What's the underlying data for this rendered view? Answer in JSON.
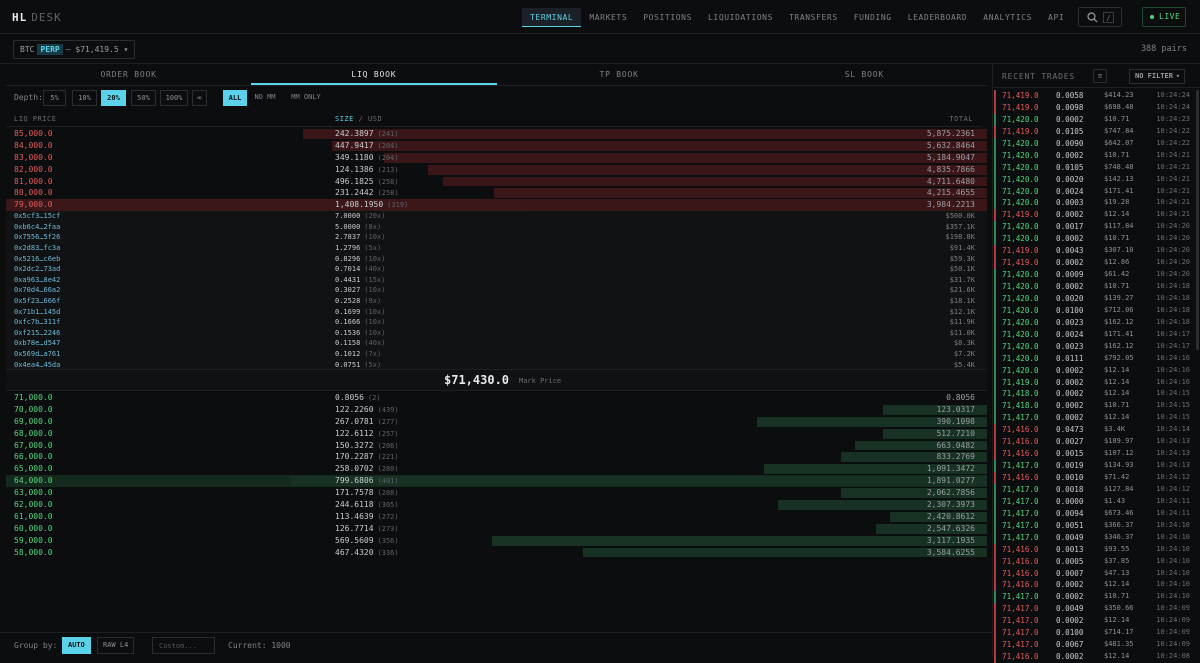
{
  "app": {
    "logo_main": "HL",
    "logo_sub": "DESK"
  },
  "nav": [
    "TERMINAL",
    "MARKETS",
    "POSITIONS",
    "LIQUIDATIONS",
    "TRANSFERS",
    "FUNDING",
    "LEADERBOARD",
    "ANALYTICS",
    "API"
  ],
  "search_shortcut": "/",
  "live_label": "LIVE",
  "pair": {
    "base": "BTC",
    "tag": "PERP",
    "price": "— $71,419.5",
    "caret": "▾"
  },
  "pairs_count": "388 pairs",
  "tabs": [
    "ORDER BOOK",
    "LIQ BOOK",
    "TP BOOK",
    "SL BOOK"
  ],
  "depth": {
    "label": "Depth:",
    "options": [
      "5%",
      "10%",
      "20%",
      "50%",
      "100%",
      "∞"
    ],
    "selected": "20%"
  },
  "mm_filter": {
    "options": [
      "ALL",
      "NO MM",
      "MM ONLY"
    ],
    "selected": "ALL"
  },
  "columns": {
    "price": "LIQ PRICE",
    "size": "SIZE",
    "sep": "/",
    "usd": "USD",
    "total": "TOTAL"
  },
  "asks": [
    {
      "price": "85,000.0",
      "size": "242.3897",
      "count": "(241)",
      "total": "5,875.2361",
      "depth": 0.93
    },
    {
      "price": "84,000.0",
      "size": "447.9417",
      "count": "(204)",
      "total": "5,632.8464",
      "depth": 0.89
    },
    {
      "price": "83,000.0",
      "size": "349.1180",
      "count": "(204)",
      "total": "5,184.9047",
      "depth": 0.82
    },
    {
      "price": "82,000.0",
      "size": "124.1386",
      "count": "(213)",
      "total": "4,835.7866",
      "depth": 0.76
    },
    {
      "price": "81,000.0",
      "size": "496.1825",
      "count": "(258)",
      "total": "4,711.6480",
      "depth": 0.74
    },
    {
      "price": "80,000.0",
      "size": "231.2442",
      "count": "(258)",
      "total": "4,215.4655",
      "depth": 0.67
    },
    {
      "price": "79,000.0",
      "size": "1,408.1950",
      "count": "(319)",
      "total": "3,984.2213",
      "depth": 0.63
    }
  ],
  "wallets": [
    {
      "addr": "0x5cf3…15cf",
      "size": "7.0000",
      "lev": "(20x)",
      "usd": "$500.0K"
    },
    {
      "addr": "0xb6c4…2faa",
      "size": "5.0000",
      "lev": "(8x)",
      "usd": "$357.1K"
    },
    {
      "addr": "0x7556…5f26",
      "size": "2.7837",
      "lev": "(10x)",
      "usd": "$198.8K"
    },
    {
      "addr": "0x2d83…fc3a",
      "size": "1.2796",
      "lev": "(5x)",
      "usd": "$91.4K"
    },
    {
      "addr": "0x5216…c6eb",
      "size": "0.8296",
      "lev": "(10x)",
      "usd": "$59.3K"
    },
    {
      "addr": "0x2dc2…73ad",
      "size": "0.7014",
      "lev": "(40x)",
      "usd": "$50.1K"
    },
    {
      "addr": "0xa963…8e42",
      "size": "0.4431",
      "lev": "(15x)",
      "usd": "$31.7K"
    },
    {
      "addr": "0x70d4…66a2",
      "size": "0.3027",
      "lev": "(10x)",
      "usd": "$21.6K"
    },
    {
      "addr": "0x5f23…666f",
      "size": "0.2528",
      "lev": "(9x)",
      "usd": "$18.1K"
    },
    {
      "addr": "0x71b1…145d",
      "size": "0.1699",
      "lev": "(10x)",
      "usd": "$12.1K"
    },
    {
      "addr": "0xfc7b…311f",
      "size": "0.1666",
      "lev": "(10x)",
      "usd": "$11.9K"
    },
    {
      "addr": "0xf215…2246",
      "size": "0.1536",
      "lev": "(10x)",
      "usd": "$11.0K"
    },
    {
      "addr": "0xb78e…d547",
      "size": "0.1158",
      "lev": "(40x)",
      "usd": "$8.3K"
    },
    {
      "addr": "0x569d…a761",
      "size": "0.1012",
      "lev": "(7x)",
      "usd": "$7.2K"
    },
    {
      "addr": "0x4ea4…45da",
      "size": "0.0751",
      "lev": "(5x)",
      "usd": "$5.4K"
    }
  ],
  "mark": {
    "price": "$71,430.0",
    "label": "Mark Price"
  },
  "bids": [
    {
      "price": "71,000.0",
      "size": "0.8056",
      "count": "(2)",
      "total": "0.8056",
      "depth": 0.0
    },
    {
      "price": "70,000.0",
      "size": "122.2260",
      "count": "(439)",
      "total": "123.0317",
      "depth": 0.15
    },
    {
      "price": "69,000.0",
      "size": "267.0781",
      "count": "(277)",
      "total": "390.1098",
      "depth": 0.33
    },
    {
      "price": "68,000.0",
      "size": "122.6112",
      "count": "(257)",
      "total": "512.7210",
      "depth": 0.15
    },
    {
      "price": "67,000.0",
      "size": "150.3272",
      "count": "(206)",
      "total": "663.0482",
      "depth": 0.19
    },
    {
      "price": "66,000.0",
      "size": "170.2287",
      "count": "(221)",
      "total": "833.2769",
      "depth": 0.21
    },
    {
      "price": "65,000.0",
      "size": "258.0702",
      "count": "(280)",
      "total": "1,091.3472",
      "depth": 0.32
    },
    {
      "price": "64,000.0",
      "size": "799.6806",
      "count": "(401)",
      "total": "1,891.0277",
      "depth": 1.0
    },
    {
      "price": "63,000.0",
      "size": "171.7578",
      "count": "(288)",
      "total": "2,062.7856",
      "depth": 0.21
    },
    {
      "price": "62,000.0",
      "size": "244.6118",
      "count": "(305)",
      "total": "2,307.3973",
      "depth": 0.3
    },
    {
      "price": "61,000.0",
      "size": "113.4639",
      "count": "(272)",
      "total": "2,420.8612",
      "depth": 0.14
    },
    {
      "price": "60,000.0",
      "size": "126.7714",
      "count": "(273)",
      "total": "2,547.6326",
      "depth": 0.16
    },
    {
      "price": "59,000.0",
      "size": "569.5609",
      "count": "(356)",
      "total": "3,117.1935",
      "depth": 0.71
    },
    {
      "price": "58,000.0",
      "size": "467.4320",
      "count": "(336)",
      "total": "3,584.6255",
      "depth": 0.58
    }
  ],
  "footer": {
    "group_label": "Group by:",
    "options": [
      "AUTO",
      "RAW L4"
    ],
    "custom_placeholder": "Custom...",
    "current": "Current: 1000"
  },
  "side": {
    "title": "RECENT TRADES",
    "btn": "≡",
    "filter": "NO FILTER",
    "filter_caret": "▾"
  },
  "trades": [
    {
      "side": "sell",
      "price": "71,419.0",
      "size": "0.0058",
      "usd": "$414.23",
      "time": "10:24:24"
    },
    {
      "side": "sell",
      "price": "71,419.0",
      "size": "0.0098",
      "usd": "$698.48",
      "time": "10:24:24"
    },
    {
      "side": "buy",
      "price": "71,420.0",
      "size": "0.0002",
      "usd": "$10.71",
      "time": "10:24:23"
    },
    {
      "side": "sell",
      "price": "71,419.0",
      "size": "0.0105",
      "usd": "$747.84",
      "time": "10:24:22"
    },
    {
      "side": "buy",
      "price": "71,420.0",
      "size": "0.0090",
      "usd": "$642.07",
      "time": "10:24:22"
    },
    {
      "side": "buy",
      "price": "71,420.0",
      "size": "0.0002",
      "usd": "$10.71",
      "time": "10:24:21"
    },
    {
      "side": "buy",
      "price": "71,420.0",
      "size": "0.0105",
      "usd": "$748.48",
      "time": "10:24:21"
    },
    {
      "side": "buy",
      "price": "71,420.0",
      "size": "0.0020",
      "usd": "$142.13",
      "time": "10:24:21"
    },
    {
      "side": "buy",
      "price": "71,420.0",
      "size": "0.0024",
      "usd": "$171.41",
      "time": "10:24:21"
    },
    {
      "side": "buy",
      "price": "71,420.0",
      "size": "0.0003",
      "usd": "$19.28",
      "time": "10:24:21"
    },
    {
      "side": "sell",
      "price": "71,419.0",
      "size": "0.0002",
      "usd": "$12.14",
      "time": "10:24:21"
    },
    {
      "side": "buy",
      "price": "71,420.0",
      "size": "0.0017",
      "usd": "$117.84",
      "time": "10:24:20"
    },
    {
      "side": "buy",
      "price": "71,420.0",
      "size": "0.0002",
      "usd": "$10.71",
      "time": "10:24:20"
    },
    {
      "side": "sell",
      "price": "71,419.0",
      "size": "0.0043",
      "usd": "$307.10",
      "time": "10:24:20"
    },
    {
      "side": "sell",
      "price": "71,419.0",
      "size": "0.0002",
      "usd": "$12.86",
      "time": "10:24:20"
    },
    {
      "side": "buy",
      "price": "71,420.0",
      "size": "0.0009",
      "usd": "$61.42",
      "time": "10:24:20"
    },
    {
      "side": "buy",
      "price": "71,420.0",
      "size": "0.0002",
      "usd": "$10.71",
      "time": "10:24:18"
    },
    {
      "side": "buy",
      "price": "71,420.0",
      "size": "0.0020",
      "usd": "$139.27",
      "time": "10:24:18"
    },
    {
      "side": "buy",
      "price": "71,420.0",
      "size": "0.0100",
      "usd": "$712.06",
      "time": "10:24:18"
    },
    {
      "side": "buy",
      "price": "71,420.0",
      "size": "0.0023",
      "usd": "$162.12",
      "time": "10:24:18"
    },
    {
      "side": "buy",
      "price": "71,420.0",
      "size": "0.0024",
      "usd": "$171.41",
      "time": "10:24:17"
    },
    {
      "side": "buy",
      "price": "71,420.0",
      "size": "0.0023",
      "usd": "$162.12",
      "time": "10:24:17"
    },
    {
      "side": "buy",
      "price": "71,420.0",
      "size": "0.0111",
      "usd": "$792.05",
      "time": "10:24:16"
    },
    {
      "side": "buy",
      "price": "71,420.0",
      "size": "0.0002",
      "usd": "$12.14",
      "time": "10:24:16"
    },
    {
      "side": "buy",
      "price": "71,419.0",
      "size": "0.0002",
      "usd": "$12.14",
      "time": "10:24:16"
    },
    {
      "side": "buy",
      "price": "71,418.0",
      "size": "0.0002",
      "usd": "$12.14",
      "time": "10:24:15"
    },
    {
      "side": "buy",
      "price": "71,418.0",
      "size": "0.0002",
      "usd": "$10.71",
      "time": "10:24:15"
    },
    {
      "side": "buy",
      "price": "71,417.0",
      "size": "0.0002",
      "usd": "$12.14",
      "time": "10:24:15"
    },
    {
      "side": "sell",
      "price": "71,416.0",
      "size": "0.0473",
      "usd": "$3.4K",
      "time": "10:24:14"
    },
    {
      "side": "sell",
      "price": "71,416.0",
      "size": "0.0027",
      "usd": "$189.97",
      "time": "10:24:13"
    },
    {
      "side": "sell",
      "price": "71,416.0",
      "size": "0.0015",
      "usd": "$107.12",
      "time": "10:24:13"
    },
    {
      "side": "buy",
      "price": "71,417.0",
      "size": "0.0019",
      "usd": "$134.93",
      "time": "10:24:13"
    },
    {
      "side": "sell",
      "price": "71,416.0",
      "size": "0.0010",
      "usd": "$71.42",
      "time": "10:24:12"
    },
    {
      "side": "buy",
      "price": "71,417.0",
      "size": "0.0018",
      "usd": "$127.84",
      "time": "10:24:12"
    },
    {
      "side": "buy",
      "price": "71,417.0",
      "size": "0.0000",
      "usd": "$1.43",
      "time": "10:24:11"
    },
    {
      "side": "buy",
      "price": "71,417.0",
      "size": "0.0094",
      "usd": "$673.46",
      "time": "10:24:11"
    },
    {
      "side": "buy",
      "price": "71,417.0",
      "size": "0.0051",
      "usd": "$366.37",
      "time": "10:24:10"
    },
    {
      "side": "buy",
      "price": "71,417.0",
      "size": "0.0049",
      "usd": "$346.37",
      "time": "10:24:10"
    },
    {
      "side": "sell",
      "price": "71,416.0",
      "size": "0.0013",
      "usd": "$93.55",
      "time": "10:24:10"
    },
    {
      "side": "sell",
      "price": "71,416.0",
      "size": "0.0005",
      "usd": "$37.85",
      "time": "10:24:10"
    },
    {
      "side": "sell",
      "price": "71,416.0",
      "size": "0.0007",
      "usd": "$47.13",
      "time": "10:24:10"
    },
    {
      "side": "sell",
      "price": "71,416.0",
      "size": "0.0002",
      "usd": "$12.14",
      "time": "10:24:10"
    },
    {
      "side": "buy",
      "price": "71,417.0",
      "size": "0.0002",
      "usd": "$10.71",
      "time": "10:24:10"
    },
    {
      "side": "sell",
      "price": "71,417.0",
      "size": "0.0049",
      "usd": "$350.66",
      "time": "10:24:09"
    },
    {
      "side": "sell",
      "price": "71,417.0",
      "size": "0.0002",
      "usd": "$12.14",
      "time": "10:24:09"
    },
    {
      "side": "sell",
      "price": "71,417.0",
      "size": "0.0100",
      "usd": "$714.17",
      "time": "10:24:09"
    },
    {
      "side": "sell",
      "price": "71,417.0",
      "size": "0.0067",
      "usd": "$481.35",
      "time": "10:24:09"
    },
    {
      "side": "sell",
      "price": "71,416.0",
      "size": "0.0002",
      "usd": "$12.14",
      "time": "10:24:08"
    }
  ],
  "colors": {
    "accent": "#5ad2ea",
    "ask": "#e65a5a",
    "bid": "#56d57d",
    "bg": "#0c0d0e"
  }
}
